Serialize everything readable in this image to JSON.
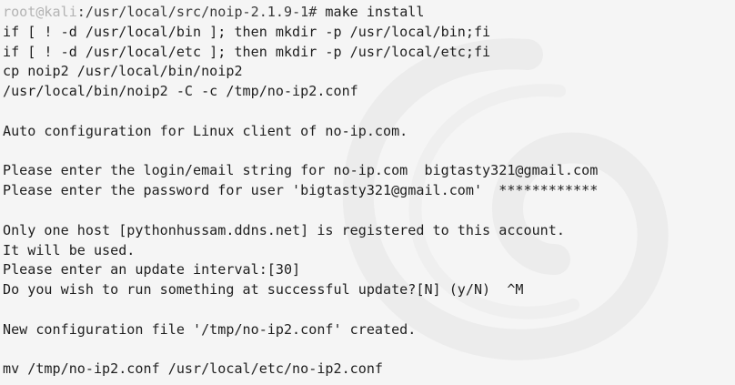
{
  "terminal": {
    "prompt": {
      "user_host": "root@kali",
      "path": ":/usr/local/src/noip-2.1.9-1#",
      "command": " make install"
    },
    "lines": [
      "if [ ! -d /usr/local/bin ]; then mkdir -p /usr/local/bin;fi",
      "if [ ! -d /usr/local/etc ]; then mkdir -p /usr/local/etc;fi",
      "cp noip2 /usr/local/bin/noip2",
      "/usr/local/bin/noip2 -C -c /tmp/no-ip2.conf",
      "",
      "Auto configuration for Linux client of no-ip.com.",
      "",
      "Please enter the login/email string for no-ip.com  bigtasty321@gmail.com",
      "Please enter the password for user 'bigtasty321@gmail.com'  ************",
      "",
      "Only one host [pythonhussam.ddns.net] is registered to this account.",
      "It will be used.",
      "Please enter an update interval:[30]",
      "Do you wish to run something at successful update?[N] (y/N)  ^M",
      "",
      "New configuration file '/tmp/no-ip2.conf' created.",
      "",
      "mv /tmp/no-ip2.conf /usr/local/etc/no-ip2.conf"
    ]
  }
}
